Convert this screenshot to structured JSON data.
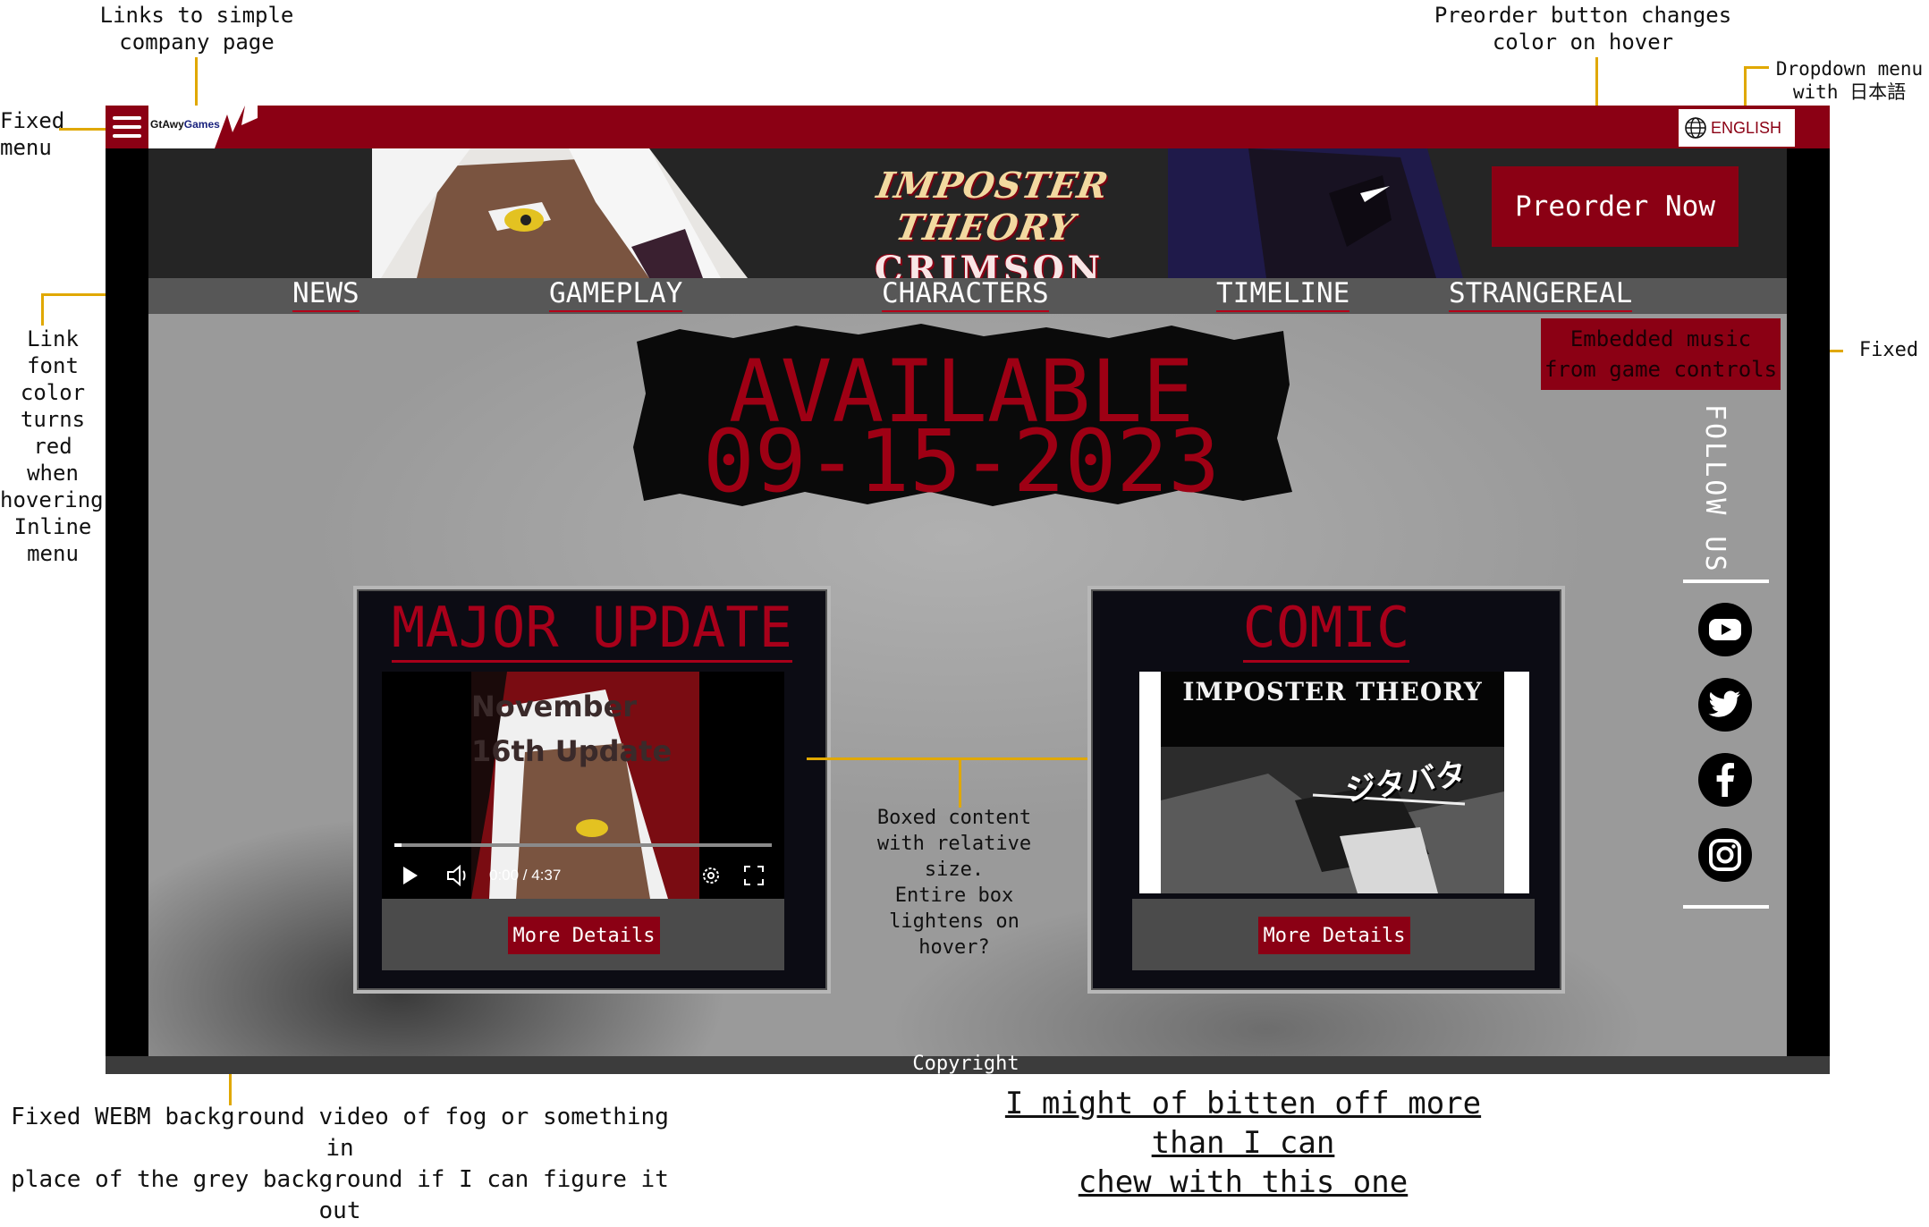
{
  "annotations": {
    "company_link": [
      "Links to simple",
      "company page"
    ],
    "fixed_menu": [
      "Fixed",
      "menu"
    ],
    "preorder_hover": [
      "Preorder button changes",
      "color on hover"
    ],
    "dropdown": [
      "Dropdown menu",
      "with 日本語"
    ],
    "link_hover": [
      "Link font",
      "color",
      "turns red",
      "when",
      "hovering.",
      "Inline",
      "menu"
    ],
    "fixed_music": "Fixed",
    "boxed": [
      "Boxed content",
      "with relative size.",
      "Entire box",
      "lightens on",
      "hover?"
    ],
    "background_video": [
      "Fixed WEBM background video of fog or something in",
      "place of the grey background if I can figure it out"
    ],
    "remark": [
      "I might of bitten off more than I can",
      "chew with this one"
    ]
  },
  "header": {
    "logo": {
      "part1": "GtAwy",
      "part2": "Games"
    },
    "language": "ENGLISH"
  },
  "banner": {
    "title_line1": "IMPOSTER THEORY",
    "title_line2": "CRIMSON CASTLE",
    "preorder": "Preorder Now"
  },
  "nav": [
    "NEWS",
    "GAMEPLAY",
    "CHARACTERS",
    "TIMELINE",
    "STRANGEREAL"
  ],
  "music": [
    "Embedded music",
    "from game controls"
  ],
  "available": {
    "line1": "AVAILABLE",
    "line2": "09-15-2023"
  },
  "update_box": {
    "title": "MAJOR UPDATE",
    "video_text": [
      "November",
      "16th Update"
    ],
    "time": "0:00 / 4:37",
    "button": "More Details"
  },
  "comic_box": {
    "title": "COMIC",
    "comic_title": "IMPOSTER THEORY",
    "sfx": "ジタバタ",
    "button": "More Details"
  },
  "follow": "FOLLOW US",
  "social": [
    "youtube-icon",
    "twitter-icon",
    "facebook-icon",
    "instagram-icon"
  ],
  "footer": {
    "copyright": "Copyright"
  },
  "colors": {
    "brand": "#8b0014",
    "accent_line": "#e0a800",
    "nav_bg": "#575757"
  }
}
